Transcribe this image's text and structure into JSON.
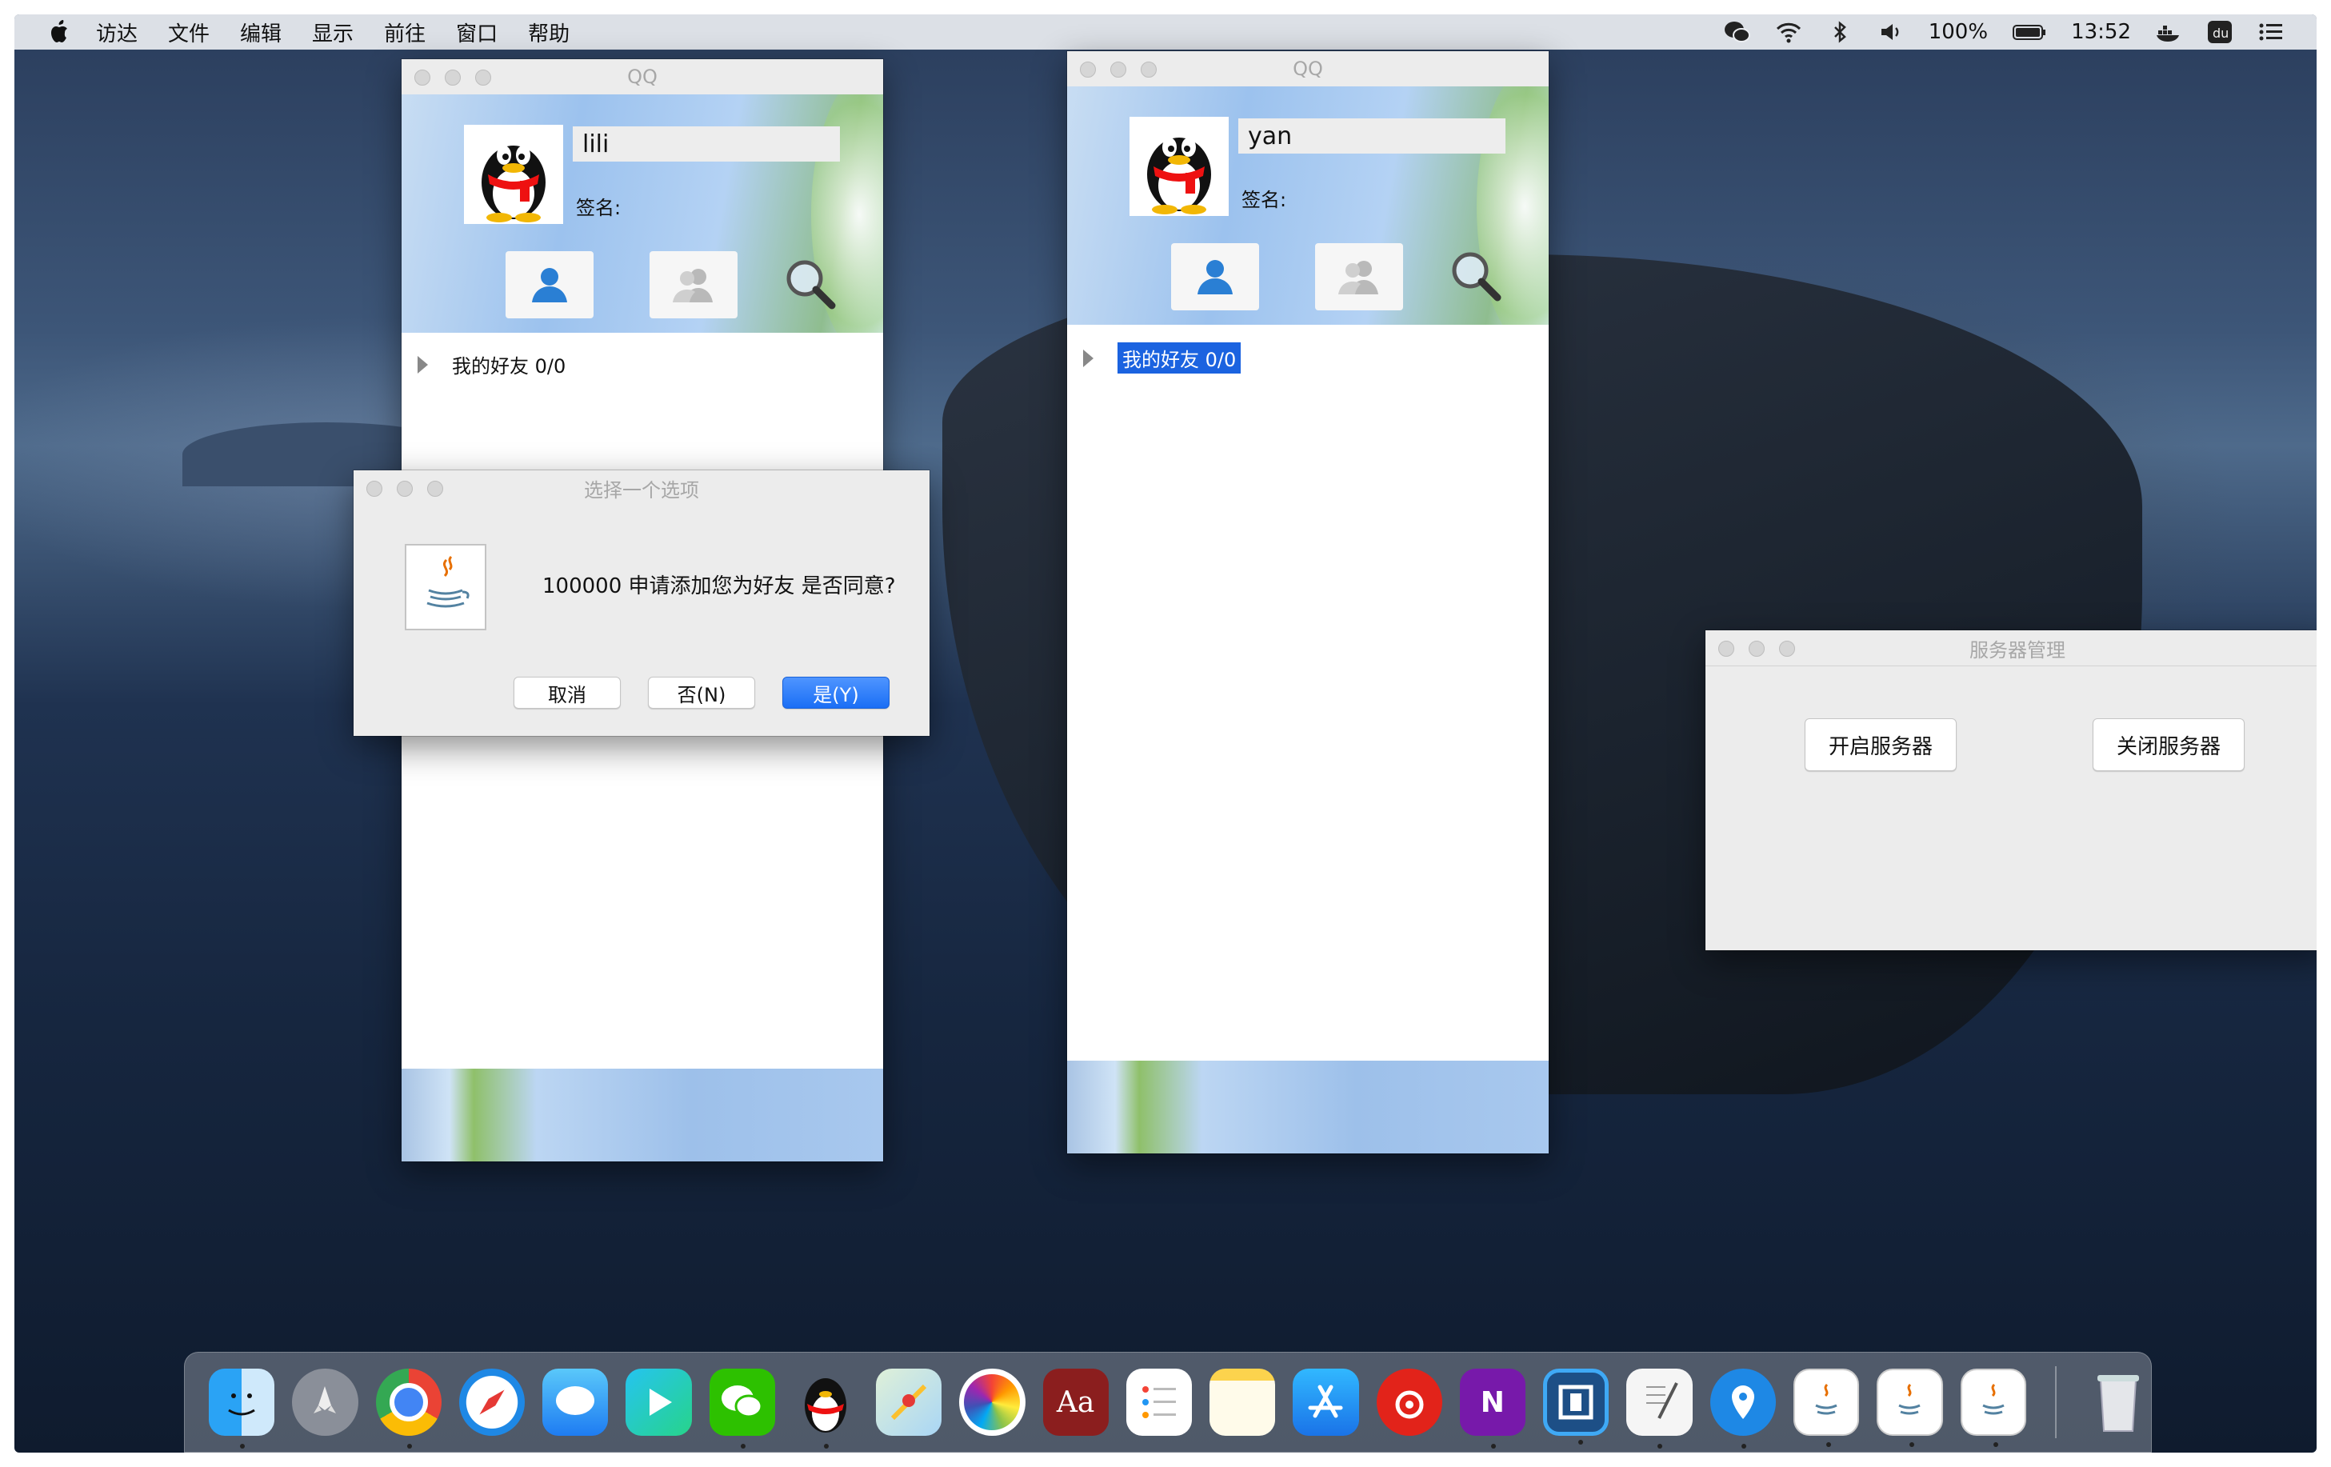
{
  "menubar": {
    "items": [
      "访达",
      "文件",
      "编辑",
      "显示",
      "前往",
      "窗口",
      "帮助"
    ],
    "battery": "100%",
    "time": "13:52"
  },
  "qq_left": {
    "title": "QQ",
    "username": "lili",
    "signature_label": "签名:",
    "group_label": "我的好友 0/0"
  },
  "qq_right": {
    "title": "QQ",
    "username": "yan",
    "signature_label": "签名:",
    "group_label": "我的好友 0/0"
  },
  "dialog": {
    "title": "选择一个选项",
    "message": "100000 申请添加您为好友  是否同意?",
    "cancel": "取消",
    "no": "否(N)",
    "yes": "是(Y)"
  },
  "server": {
    "title": "服务器管理",
    "start": "开启服务器",
    "stop": "关闭服务器"
  },
  "dock": {
    "dictionary_glyph": "Aa",
    "onenote_glyph": "N",
    "apps": [
      "finder-icon",
      "launchpad-icon",
      "chrome-icon",
      "safari-icon",
      "messages-icon",
      "video-icon",
      "wechat-icon",
      "qq-icon",
      "maps-icon",
      "photos-icon",
      "dictionary-icon",
      "reminders-icon",
      "notes-icon",
      "appstore-icon",
      "netease-music-icon",
      "onenote-icon",
      "remote-desktop-icon",
      "textedit-icon",
      "location-icon",
      "java-app-icon-1",
      "java-app-icon-2",
      "java-app-icon-3",
      "trash-icon"
    ]
  },
  "colors": {
    "selection": "#1b63e0",
    "primary_button": "#1a6ef5"
  }
}
